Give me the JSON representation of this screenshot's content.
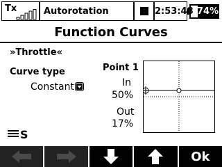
{
  "status_bar": {
    "tx_label": "Tx",
    "signal_bars_icon": "signal-bars-icon",
    "model_name": "Autorotation",
    "recording_icon": "stop-square-icon",
    "time": "2:53:48",
    "battery_percent": "74%",
    "battery_level": 0.74
  },
  "page": {
    "title": "Function Curves"
  },
  "main": {
    "function_name": "»Throttle«",
    "curve_type_label": "Curve type",
    "curve_type_value": "Constant",
    "point_label": "Point 1",
    "in_label": "In",
    "in_value": "50%",
    "out_label": "Out",
    "out_value": "17%",
    "stick_switch_label": "S"
  },
  "curve_graph": {
    "constant_output_percent": 17,
    "input_marker_percent": 50
  },
  "softkeys": [
    {
      "name": "softkey-left",
      "icon": "arrow-left-icon",
      "label": "",
      "enabled": false
    },
    {
      "name": "softkey-right",
      "icon": "arrow-right-icon",
      "label": "",
      "enabled": false
    },
    {
      "name": "softkey-down",
      "icon": "arrow-down-icon",
      "label": "",
      "enabled": true
    },
    {
      "name": "softkey-up",
      "icon": "arrow-up-icon",
      "label": "",
      "enabled": true
    },
    {
      "name": "softkey-ok",
      "icon": "",
      "label": "Ok",
      "enabled": true
    }
  ],
  "colors": {
    "foreground": "#000000",
    "background": "#ffffff"
  }
}
